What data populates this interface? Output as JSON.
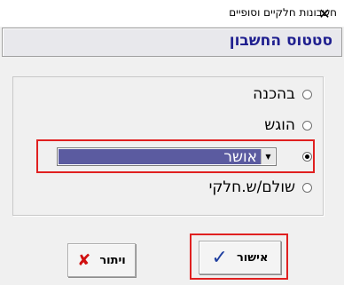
{
  "window": {
    "title": "חשבונות חלקיים וסופיים",
    "close_icon": "close-icon"
  },
  "header": {
    "title": "סטטוס החשבון"
  },
  "status_options": [
    {
      "label": "בהכנה",
      "checked": false
    },
    {
      "label": "הוגש",
      "checked": false
    },
    {
      "label": "",
      "checked": true
    },
    {
      "label": "שולם/ש.חלקי",
      "checked": false
    }
  ],
  "status_select": {
    "value": "אושר",
    "arrow_icon": "chevron-down-icon"
  },
  "buttons": {
    "cancel_label": "ויתור",
    "cancel_icon": "x-mark-icon",
    "ok_label": "אישור",
    "ok_icon": "checkmark-icon"
  },
  "colors": {
    "header_text": "#1f1f8f",
    "selection_bg": "#5b5ba0",
    "highlight": "#e02020"
  }
}
